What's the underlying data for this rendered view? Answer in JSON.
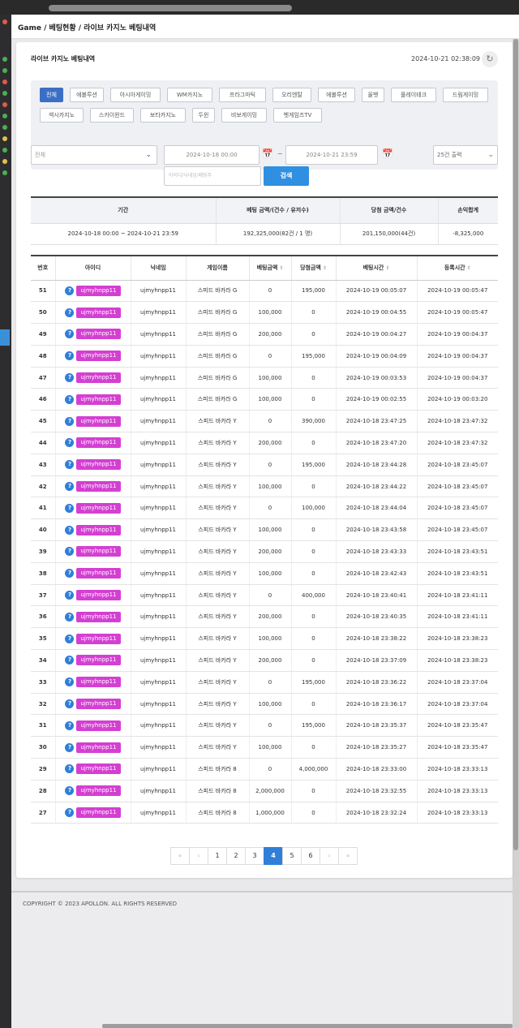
{
  "breadcrumb": "Game / 베팅현황 / 라이브 카지노 베팅내역",
  "card": {
    "title": "라이브 카지노 베팅내역",
    "timestamp": "2024-10-21 02:38:09"
  },
  "vendor_tabs": [
    {
      "label": "전체",
      "active": true
    },
    {
      "label": "에볼루션",
      "active": false
    },
    {
      "label": "아시아게이밍",
      "active": false
    },
    {
      "label": "WM카지노",
      "active": false
    },
    {
      "label": "프라그마틱",
      "active": false
    },
    {
      "label": "오리엔탈",
      "active": false
    },
    {
      "label": "에볼루션",
      "active": false
    },
    {
      "label": "올벳",
      "active": false
    },
    {
      "label": "플레이테크",
      "active": false
    },
    {
      "label": "드림게이밍",
      "active": false
    },
    {
      "label": "섹시카지노",
      "active": false
    },
    {
      "label": "스카이윈드",
      "active": false
    },
    {
      "label": "보타카지노",
      "active": false
    },
    {
      "label": "두윈",
      "active": false
    },
    {
      "label": "비보게이밍",
      "active": false
    },
    {
      "label": "벳게임즈TV",
      "active": false
    }
  ],
  "filters": {
    "category": "전체",
    "date_start": "2024-10-18 00:00",
    "date_end": "2024-10-21 23:59",
    "page_size": "25건 출력",
    "search_placeholder": "아이디/닉네임/배팅주",
    "search_label": "검색"
  },
  "summary": {
    "headers": [
      "기간",
      "베팅 금액/(건수 / 유저수)",
      "당첨 금액/건수",
      "손익합계"
    ],
    "row": [
      "2024-10-18 00:00 ~ 2024-10-21 23:59",
      "192,325,000(82건 / 1 명)",
      "201,150,000(44건)",
      "-8,325,000"
    ]
  },
  "table": {
    "headers": [
      "번호",
      "아이디",
      "닉네임",
      "게임이름",
      "베팅금액",
      "당첨금액",
      "베팅시간",
      "등록시간"
    ],
    "rows": [
      [
        "51",
        "ujmyhnpp11",
        "ujmyhnpp11",
        "스피드 바카라 G",
        "0",
        "195,000",
        "2024-10-19 00:05:07",
        "2024-10-19 00:05:47"
      ],
      [
        "50",
        "ujmyhnpp11",
        "ujmyhnpp11",
        "스피드 바카라 G",
        "100,000",
        "0",
        "2024-10-19 00:04:55",
        "2024-10-19 00:05:47"
      ],
      [
        "49",
        "ujmyhnpp11",
        "ujmyhnpp11",
        "스피드 바카라 G",
        "200,000",
        "0",
        "2024-10-19 00:04:27",
        "2024-10-19 00:04:37"
      ],
      [
        "48",
        "ujmyhnpp11",
        "ujmyhnpp11",
        "스피드 바카라 G",
        "0",
        "195,000",
        "2024-10-19 00:04:09",
        "2024-10-19 00:04:37"
      ],
      [
        "47",
        "ujmyhnpp11",
        "ujmyhnpp11",
        "스피드 바카라 G",
        "100,000",
        "0",
        "2024-10-19 00:03:53",
        "2024-10-19 00:04:37"
      ],
      [
        "46",
        "ujmyhnpp11",
        "ujmyhnpp11",
        "스피드 바카라 G",
        "100,000",
        "0",
        "2024-10-19 00:02:55",
        "2024-10-19 00:03:20"
      ],
      [
        "45",
        "ujmyhnpp11",
        "ujmyhnpp11",
        "스피드 바카라 Y",
        "0",
        "390,000",
        "2024-10-18 23:47:25",
        "2024-10-18 23:47:32"
      ],
      [
        "44",
        "ujmyhnpp11",
        "ujmyhnpp11",
        "스피드 바카라 Y",
        "200,000",
        "0",
        "2024-10-18 23:47:20",
        "2024-10-18 23:47:32"
      ],
      [
        "43",
        "ujmyhnpp11",
        "ujmyhnpp11",
        "스피드 바카라 Y",
        "0",
        "195,000",
        "2024-10-18 23:44:28",
        "2024-10-18 23:45:07"
      ],
      [
        "42",
        "ujmyhnpp11",
        "ujmyhnpp11",
        "스피드 바카라 Y",
        "100,000",
        "0",
        "2024-10-18 23:44:22",
        "2024-10-18 23:45:07"
      ],
      [
        "41",
        "ujmyhnpp11",
        "ujmyhnpp11",
        "스피드 바카라 Y",
        "0",
        "100,000",
        "2024-10-18 23:44:04",
        "2024-10-18 23:45:07"
      ],
      [
        "40",
        "ujmyhnpp11",
        "ujmyhnpp11",
        "스피드 바카라 Y",
        "100,000",
        "0",
        "2024-10-18 23:43:58",
        "2024-10-18 23:45:07"
      ],
      [
        "39",
        "ujmyhnpp11",
        "ujmyhnpp11",
        "스피드 바카라 Y",
        "200,000",
        "0",
        "2024-10-18 23:43:33",
        "2024-10-18 23:43:51"
      ],
      [
        "38",
        "ujmyhnpp11",
        "ujmyhnpp11",
        "스피드 바카라 Y",
        "100,000",
        "0",
        "2024-10-18 23:42:43",
        "2024-10-18 23:43:51"
      ],
      [
        "37",
        "ujmyhnpp11",
        "ujmyhnpp11",
        "스피드 바카라 Y",
        "0",
        "400,000",
        "2024-10-18 23:40:41",
        "2024-10-18 23:41:11"
      ],
      [
        "36",
        "ujmyhnpp11",
        "ujmyhnpp11",
        "스피드 바카라 Y",
        "200,000",
        "0",
        "2024-10-18 23:40:35",
        "2024-10-18 23:41:11"
      ],
      [
        "35",
        "ujmyhnpp11",
        "ujmyhnpp11",
        "스피드 바카라 Y",
        "100,000",
        "0",
        "2024-10-18 23:38:22",
        "2024-10-18 23:38:23"
      ],
      [
        "34",
        "ujmyhnpp11",
        "ujmyhnpp11",
        "스피드 바카라 Y",
        "200,000",
        "0",
        "2024-10-18 23:37:09",
        "2024-10-18 23:38:23"
      ],
      [
        "33",
        "ujmyhnpp11",
        "ujmyhnpp11",
        "스피드 바카라 Y",
        "0",
        "195,000",
        "2024-10-18 23:36:22",
        "2024-10-18 23:37:04"
      ],
      [
        "32",
        "ujmyhnpp11",
        "ujmyhnpp11",
        "스피드 바카라 Y",
        "100,000",
        "0",
        "2024-10-18 23:36:17",
        "2024-10-18 23:37:04"
      ],
      [
        "31",
        "ujmyhnpp11",
        "ujmyhnpp11",
        "스피드 바카라 Y",
        "0",
        "195,000",
        "2024-10-18 23:35:37",
        "2024-10-18 23:35:47"
      ],
      [
        "30",
        "ujmyhnpp11",
        "ujmyhnpp11",
        "스피드 바카라 Y",
        "100,000",
        "0",
        "2024-10-18 23:35:27",
        "2024-10-18 23:35:47"
      ],
      [
        "29",
        "ujmyhnpp11",
        "ujmyhnpp11",
        "스피드 바카라 8",
        "0",
        "4,000,000",
        "2024-10-18 23:33:00",
        "2024-10-18 23:33:13"
      ],
      [
        "28",
        "ujmyhnpp11",
        "ujmyhnpp11",
        "스피드 바카라 8",
        "2,000,000",
        "0",
        "2024-10-18 23:32:55",
        "2024-10-18 23:33:13"
      ],
      [
        "27",
        "ujmyhnpp11",
        "ujmyhnpp11",
        "스피드 바카라 8",
        "1,000,000",
        "0",
        "2024-10-18 23:32:24",
        "2024-10-18 23:33:13"
      ]
    ]
  },
  "pagination": {
    "first": "«",
    "prev": "‹",
    "pages": [
      "1",
      "2",
      "3",
      "4",
      "5",
      "6"
    ],
    "current": "4",
    "next": "›",
    "last": "»"
  },
  "footer": "COPYRIGHT © 2023 APOLLON. ALL RIGHTS RESERVED",
  "icons": {
    "refresh": "refresh-icon",
    "calendar": "calendar-icon",
    "chevron": "chevron-down-icon",
    "info": "info-icon",
    "sort": "sort-icon"
  },
  "colors": {
    "accent": "#2f7fd8",
    "badge": "#d43fd2",
    "active_tab": "#3b6fc4"
  }
}
